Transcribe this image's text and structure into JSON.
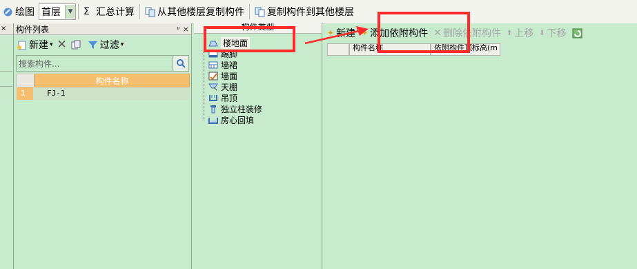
{
  "toolbar": {
    "draw_label": "绘图",
    "floor_value": "首层",
    "sum_label": "汇总计算",
    "copy_from_label": "从其他楼层复制构件",
    "copy_to_label": "复制构件到其他楼层"
  },
  "component_list": {
    "title": "构件列表",
    "pin": "ᵖ",
    "close": "×",
    "new_label": "新建",
    "filter_label": "过滤",
    "search_placeholder": "搜索构件...",
    "column_header": "构件名称",
    "rows": [
      {
        "index": "1",
        "name": "FJ-1"
      }
    ]
  },
  "type_tree": {
    "header": "构件类型",
    "items": [
      "楼地面",
      "踢脚",
      "墙裙",
      "墙面",
      "天棚",
      "吊顶",
      "独立柱装修",
      "房心回填"
    ]
  },
  "right_panel": {
    "new_label": "新建",
    "add_attach_label": "添加依附构件",
    "delete_attach_label": "删除依附构件",
    "move_up_label": "上移",
    "move_down_label": "下移",
    "columns": [
      "构件名称",
      "依附构件顶标高(m"
    ]
  },
  "colors": {
    "background": "#c8ebcd",
    "header_orange": "#f6bf6e",
    "highlight_red": "#ff2a2a"
  }
}
